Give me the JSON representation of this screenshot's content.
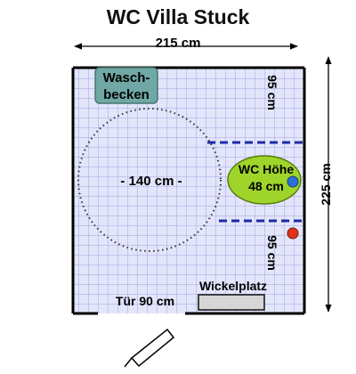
{
  "title": "WC Villa Stuck",
  "dimensions": {
    "width": "215 cm",
    "length": "225 cm",
    "clearance_top": "95 cm",
    "clearance_bottom": "95 cm",
    "turning_circle": "- 140 cm -"
  },
  "fixtures": {
    "sink_line1": "Wasch-",
    "sink_line2": "becken",
    "toilet_line1": "WC Höhe",
    "toilet_line2": "48 cm",
    "door": "Tür 90 cm",
    "changing_table": "Wickelplatz"
  },
  "colors": {
    "floor_tile": "#e3e5fb",
    "tile_lines": "#a3a6dc",
    "sink_fill": "#6fa8a4",
    "toilet_fill": "#9fd42a",
    "grab_bar": "#1c2aa6",
    "left_button": "#2d6fd8",
    "right_button": "#e0321c"
  }
}
